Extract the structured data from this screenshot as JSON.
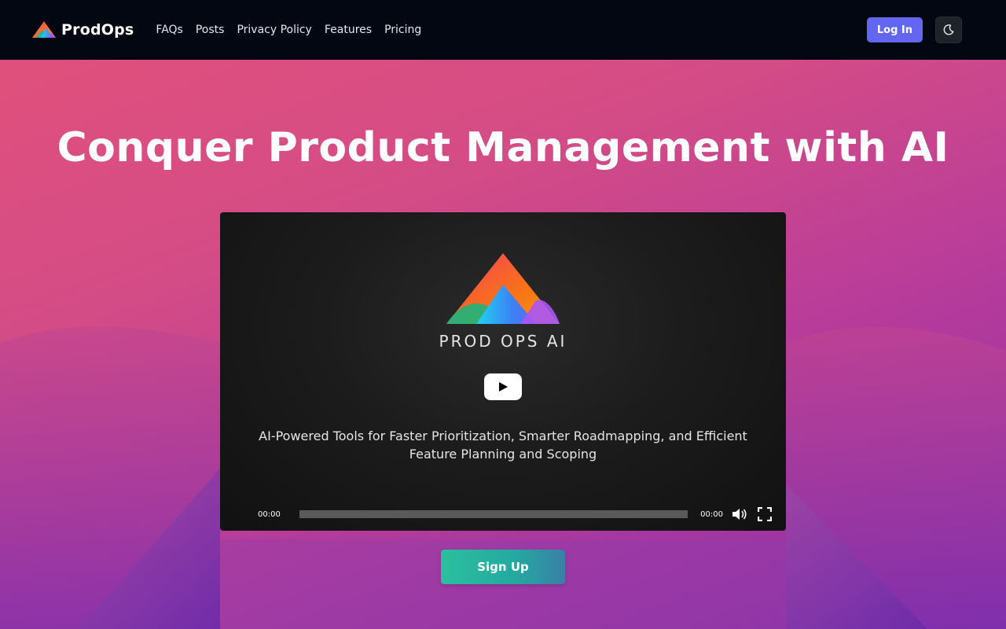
{
  "nav": {
    "brand": "ProdOps",
    "links": [
      "FAQs",
      "Posts",
      "Privacy Policy",
      "Features",
      "Pricing"
    ],
    "login_label": "Log In",
    "theme_icon": "moon-icon"
  },
  "hero": {
    "title": "Conquer Product Management with AI",
    "signup_label": "Sign Up"
  },
  "video": {
    "brand_text": "PROD OPS AI",
    "caption_line1": "AI-Powered Tools for Faster Prioritization, Smarter Roadmapping, and Efficient",
    "caption_line2": "Feature Planning and Scoping",
    "current_time": "00:00",
    "duration": "00:00",
    "progress": 0,
    "icons": [
      "play-icon",
      "volume-icon",
      "fullscreen-icon"
    ]
  },
  "colors": {
    "accent": "#6366f1",
    "nav_bg": "#030712",
    "signup_start": "#2bbf9e",
    "hero_start": "#e0507c",
    "hero_end": "#8b2fa8"
  }
}
